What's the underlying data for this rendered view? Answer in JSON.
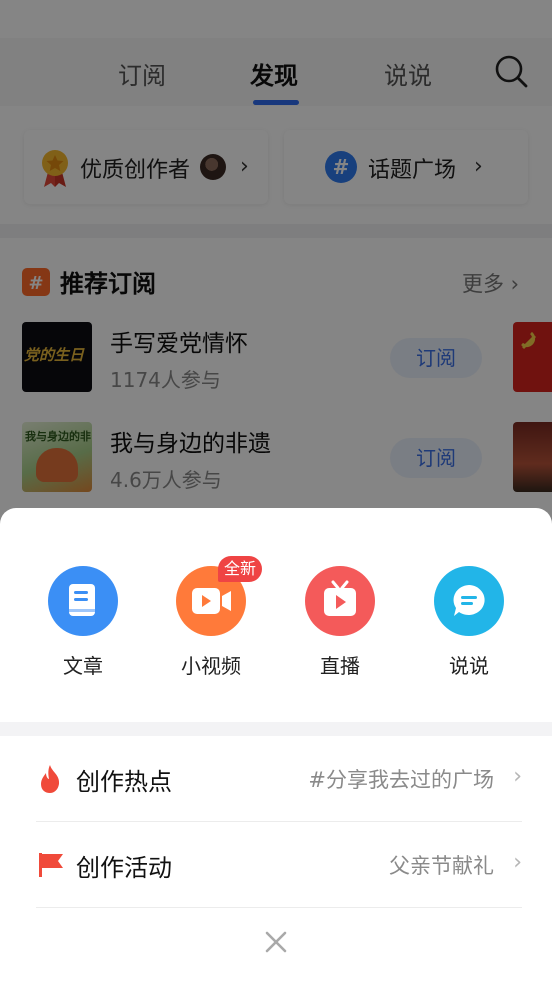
{
  "top_tabs": [
    {
      "label": "订阅",
      "active": false
    },
    {
      "label": "发现",
      "active": true
    },
    {
      "label": "说说",
      "active": false
    }
  ],
  "chips": [
    {
      "label": "优质创作者",
      "icon": "medal-icon"
    },
    {
      "label": "话题广场",
      "icon": "hashtag-icon"
    }
  ],
  "recommend": {
    "title": "推荐订阅",
    "more": "更多",
    "items": [
      {
        "title": "手写爱党情怀",
        "count": "1174人参与",
        "button": "订阅",
        "thumb_text": "党的生日"
      },
      {
        "title": "我与身边的非遗",
        "count": "4.6万人参与",
        "button": "订阅",
        "thumb_text": "我与身边的非遗"
      }
    ]
  },
  "create_sheet": {
    "items": [
      {
        "label": "文章",
        "icon": "document-icon",
        "color": "#3b8ff5"
      },
      {
        "label": "小视频",
        "icon": "video-camera-icon",
        "color": "#ff7a3a"
      },
      {
        "label": "直播",
        "icon": "tv-play-icon",
        "color": "#f45a5a"
      },
      {
        "label": "说说",
        "icon": "chat-bubble-icon",
        "color": "#22b5e8"
      }
    ],
    "new_badge": "全新",
    "rows": [
      {
        "title": "创作热点",
        "value": "#分享我去过的广场",
        "icon": "fire-icon",
        "icon_color": "#f04a3a"
      },
      {
        "title": "创作活动",
        "value": "父亲节献礼",
        "icon": "flag-icon",
        "icon_color": "#f04a3a"
      }
    ],
    "close_icon": "close-icon"
  },
  "colors": {
    "accent": "#2e6bf0",
    "subscribe_text": "#3a6fe6"
  }
}
